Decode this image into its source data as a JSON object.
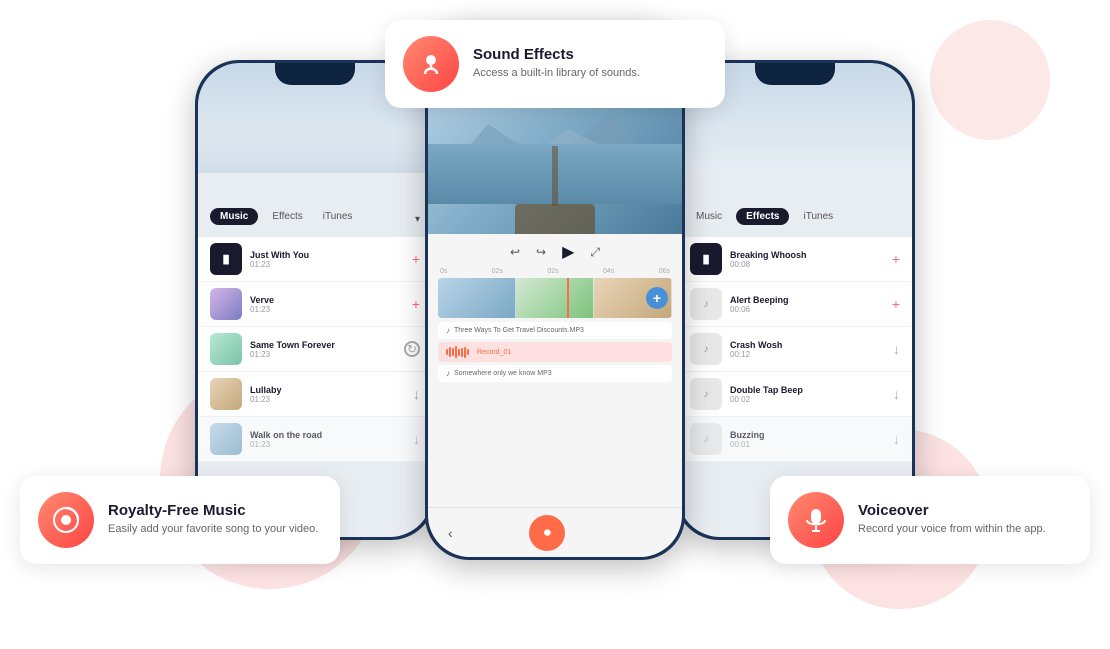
{
  "background": {
    "color": "#ffffff"
  },
  "phones": {
    "left": {
      "tabs": [
        "Music",
        "Effects",
        "iTunes"
      ],
      "active_tab": "Music",
      "music_list": [
        {
          "title": "Just With You",
          "duration": "01:23",
          "action": "+",
          "thumb": "play"
        },
        {
          "title": "Verve",
          "duration": "01:23",
          "action": "+",
          "thumb": "img1"
        },
        {
          "title": "Same Town Forever",
          "duration": "01:23",
          "action": "spinner",
          "thumb": "img2"
        },
        {
          "title": "Lullaby",
          "duration": "01:23",
          "action": "down",
          "thumb": "img3"
        },
        {
          "title": "Walk on the road",
          "duration": "01:23",
          "action": "down",
          "thumb": "img4"
        }
      ]
    },
    "center": {
      "timeline_marks": [
        "0s",
        "02s",
        "02s",
        "02s",
        "04s",
        "06s"
      ],
      "audio_tracks": [
        {
          "name": "Three Ways To Get Travel Discounts.MP3",
          "type": "music"
        },
        {
          "name": "Record_01",
          "type": "record"
        },
        {
          "name": "Somewhere only we know MP3",
          "type": "music"
        }
      ]
    },
    "right": {
      "tabs": [
        "Music",
        "Effects",
        "iTunes"
      ],
      "active_tab": "Effects",
      "effects_list": [
        {
          "title": "Breaking Whoosh",
          "duration": "00:08",
          "action": "+"
        },
        {
          "title": "Alert Beeping",
          "duration": "00:06",
          "action": "+"
        },
        {
          "title": "Crash Wosh",
          "duration": "00:12",
          "action": "down"
        },
        {
          "title": "Double Tap Beep",
          "duration": "00:02",
          "action": "down"
        },
        {
          "title": "Buzzing",
          "duration": "00:01",
          "action": "down"
        }
      ]
    }
  },
  "feature_cards": {
    "left": {
      "icon": "🎵",
      "title": "Royalty-Free Music",
      "description": "Easily add your favorite song to your video."
    },
    "center": {
      "icon": "🎤",
      "title": "Sound Effects",
      "description": "Access a built-in library of sounds."
    },
    "right": {
      "icon": "🎙",
      "title": "Voiceover",
      "description": "Record your voice from within the app."
    }
  }
}
